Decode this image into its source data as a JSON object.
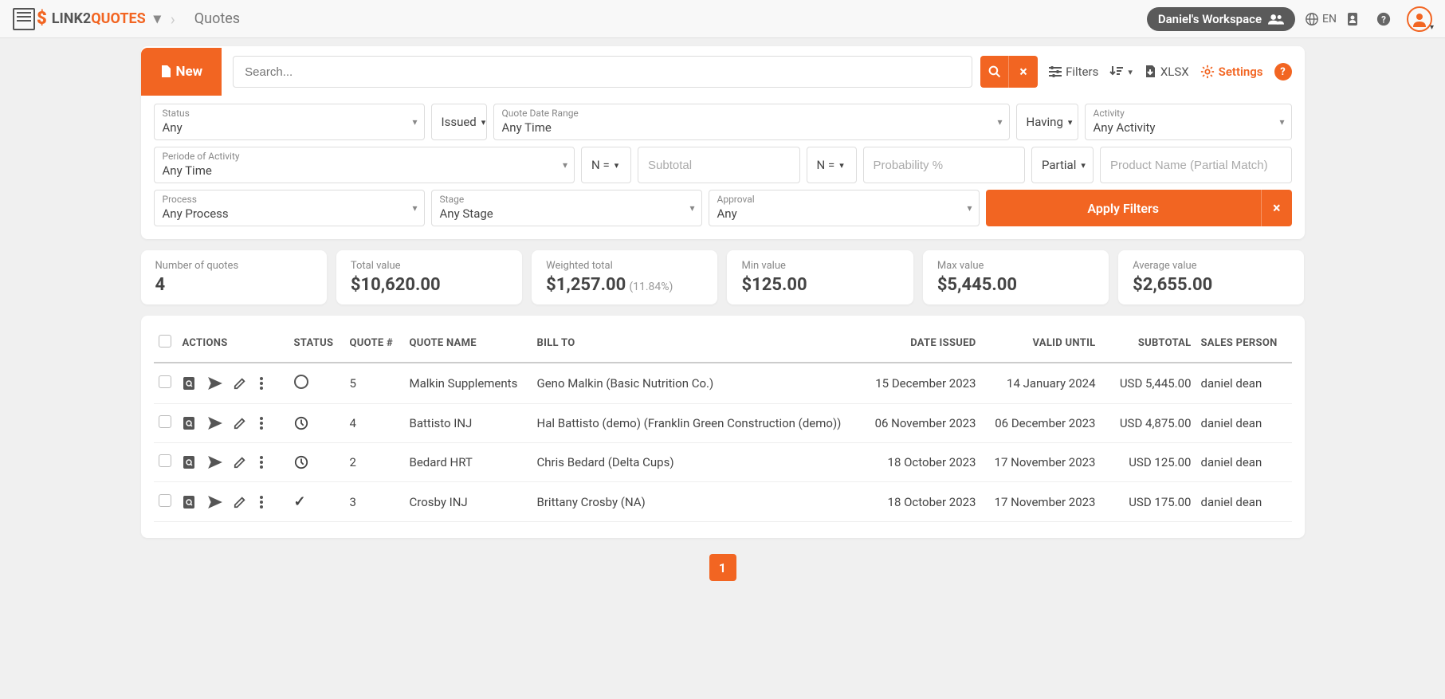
{
  "app": {
    "name_part1": "LINK2",
    "name_part2": "QUOTES"
  },
  "breadcrumb": "Quotes",
  "workspace": "Daniel's Workspace",
  "language": "EN",
  "toolbar": {
    "new": "New",
    "search_placeholder": "Search...",
    "filters": "Filters",
    "xlsx": "XLSX",
    "settings": "Settings"
  },
  "filters": {
    "status": {
      "label": "Status",
      "value": "Any"
    },
    "issued_label": "Issued",
    "quote_date_range": {
      "label": "Quote Date Range",
      "value": "Any Time"
    },
    "having_label": "Having",
    "activity": {
      "label": "Activity",
      "value": "Any Activity"
    },
    "period": {
      "label": "Periode of Activity",
      "value": "Any Time"
    },
    "neq_label": "N =",
    "subtotal_placeholder": "Subtotal",
    "probability_placeholder": "Probability %",
    "partial_label": "Partial",
    "product_placeholder": "Product Name (Partial Match)",
    "process": {
      "label": "Process",
      "value": "Any Process"
    },
    "stage": {
      "label": "Stage",
      "value": "Any Stage"
    },
    "approval": {
      "label": "Approval",
      "value": "Any"
    },
    "apply": "Apply Filters"
  },
  "stats": {
    "count": {
      "label": "Number of quotes",
      "value": "4"
    },
    "total": {
      "label": "Total value",
      "value": "$10,620.00"
    },
    "weighted": {
      "label": "Weighted total",
      "value": "$1,257.00",
      "sub": "(11.84%)"
    },
    "min": {
      "label": "Min value",
      "value": "$125.00"
    },
    "max": {
      "label": "Max value",
      "value": "$5,445.00"
    },
    "avg": {
      "label": "Average value",
      "value": "$2,655.00"
    }
  },
  "columns": {
    "actions": "ACTIONS",
    "status": "STATUS",
    "quote_num": "QUOTE #",
    "quote_name": "QUOTE NAME",
    "bill_to": "BILL TO",
    "date_issued": "DATE ISSUED",
    "valid_until": "VALID UNTIL",
    "subtotal": "SUBTOTAL",
    "sales_person": "SALES PERSON"
  },
  "rows": [
    {
      "status": "open",
      "num": "5",
      "name": "Malkin Supplements",
      "bill_to": "Geno Malkin (Basic Nutrition Co.)",
      "issued": "15 December 2023",
      "valid": "14 January 2024",
      "subtotal": "USD 5,445.00",
      "sales": "daniel dean"
    },
    {
      "status": "clock",
      "num": "4",
      "name": "Battisto INJ",
      "bill_to": "Hal Battisto (demo) (Franklin Green Construction (demo))",
      "issued": "06 November 2023",
      "valid": "06 December 2023",
      "subtotal": "USD 4,875.00",
      "sales": "daniel dean"
    },
    {
      "status": "clock",
      "num": "2",
      "name": "Bedard HRT",
      "bill_to": "Chris Bedard (Delta Cups)",
      "issued": "18 October 2023",
      "valid": "17 November 2023",
      "subtotal": "USD 125.00",
      "sales": "daniel dean"
    },
    {
      "status": "check",
      "num": "3",
      "name": "Crosby INJ",
      "bill_to": "Brittany Crosby (NA)",
      "issued": "18 October 2023",
      "valid": "17 November 2023",
      "subtotal": "USD 175.00",
      "sales": "daniel dean"
    }
  ],
  "pagination": {
    "current": "1"
  }
}
